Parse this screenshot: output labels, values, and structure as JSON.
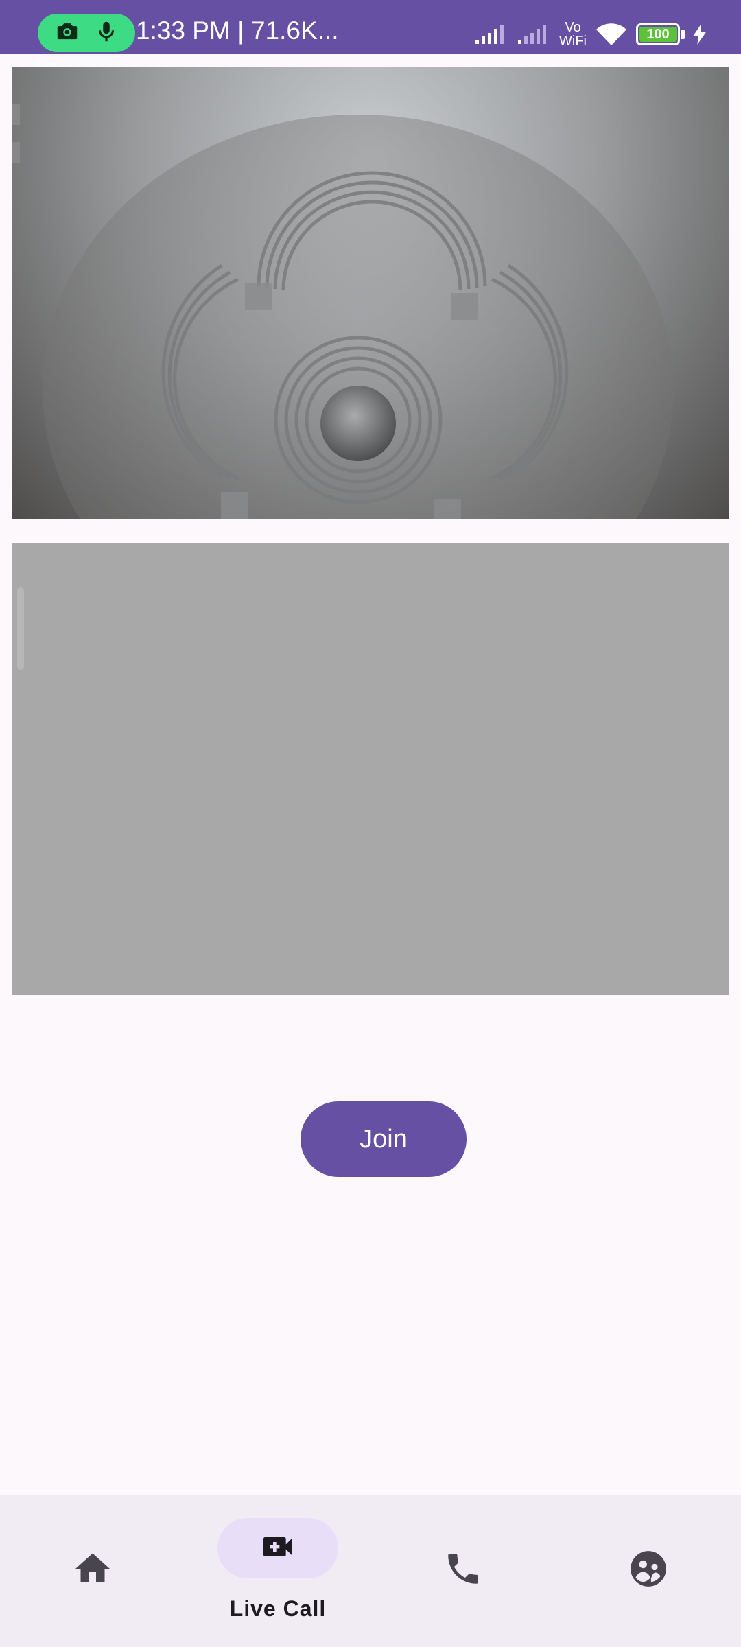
{
  "status_bar": {
    "text": "1:33 PM | 71.6K...",
    "vowifi_top": "Vo",
    "vowifi_bottom": "WiFi",
    "battery_level": "100",
    "icons": [
      "camera-icon",
      "mic-icon",
      "signal-icon",
      "signal-icon",
      "vowifi-icon",
      "wifi-icon",
      "battery-icon",
      "charging-icon"
    ]
  },
  "main": {
    "join_label": "Join"
  },
  "bottom_nav": {
    "items": [
      {
        "icon": "home-icon",
        "label": ""
      },
      {
        "icon": "video-call-add-icon",
        "label": "Live Call",
        "active": true
      },
      {
        "icon": "phone-icon",
        "label": ""
      },
      {
        "icon": "group-icon",
        "label": ""
      }
    ]
  },
  "colors": {
    "primary": "#6650a4",
    "background": "#fdf8fc",
    "nav_background": "#f1ecf4",
    "active_indicator": "#e8def8",
    "recording_pill": "#3ddc84",
    "remote_video": "#a8a8a8"
  }
}
